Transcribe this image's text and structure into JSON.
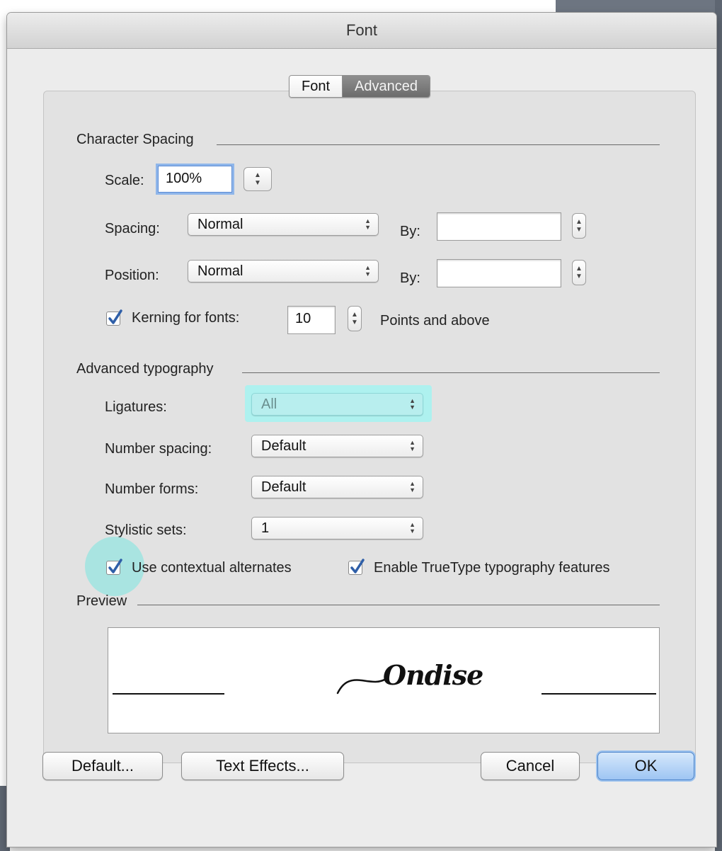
{
  "window": {
    "title": "Font"
  },
  "tabs": [
    {
      "label": "Font"
    },
    {
      "label": "Advanced",
      "selected": true
    }
  ],
  "character_spacing": {
    "heading": "Character Spacing",
    "scale": {
      "label": "Scale:",
      "value": "100%"
    },
    "spacing": {
      "label": "Spacing:",
      "value": "Normal",
      "by_label": "By:",
      "by_value": ""
    },
    "position": {
      "label": "Position:",
      "value": "Normal",
      "by_label": "By:",
      "by_value": ""
    },
    "kerning": {
      "label": "Kerning for fonts:",
      "checked": true,
      "value": "10",
      "suffix": "Points and above"
    }
  },
  "advanced_typography": {
    "heading": "Advanced typography",
    "ligatures": {
      "label": "Ligatures:",
      "value": "All",
      "disabled": true
    },
    "number_spacing": {
      "label": "Number spacing:",
      "value": "Default"
    },
    "number_forms": {
      "label": "Number forms:",
      "value": "Default"
    },
    "stylistic_sets": {
      "label": "Stylistic sets:",
      "value": "1"
    },
    "contextual_alternates": {
      "label": "Use contextual alternates",
      "checked": true
    },
    "truetype_features": {
      "label": "Enable TrueType typography features",
      "checked": true
    }
  },
  "preview": {
    "heading": "Preview",
    "sample_text": "Ondise"
  },
  "buttons": {
    "default": "Default...",
    "text_effects": "Text Effects...",
    "cancel": "Cancel",
    "ok": "OK"
  },
  "colors": {
    "accent_blue": "#5b8bd4",
    "highlight_cyan": "#aef1ef",
    "check_blue": "#2f5fa8"
  }
}
